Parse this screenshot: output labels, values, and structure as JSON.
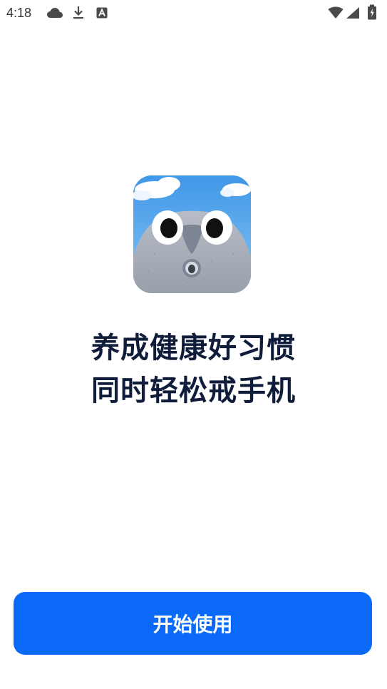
{
  "status_bar": {
    "time": "4:18",
    "icons_left": [
      "cloud-icon",
      "download-icon",
      "text-a-icon"
    ],
    "icons_right": [
      "wifi-icon",
      "cellular-signal-icon",
      "battery-charging-icon"
    ]
  },
  "app_icon": {
    "name": "app-logo-icon"
  },
  "headline": {
    "line1": "养成健康好习惯",
    "line2": "同时轻松戒手机"
  },
  "start_button": {
    "label": "开始使用"
  },
  "colors": {
    "primary": "#0a6af7",
    "headline_text": "#0f1c3a",
    "background": "#ffffff"
  }
}
